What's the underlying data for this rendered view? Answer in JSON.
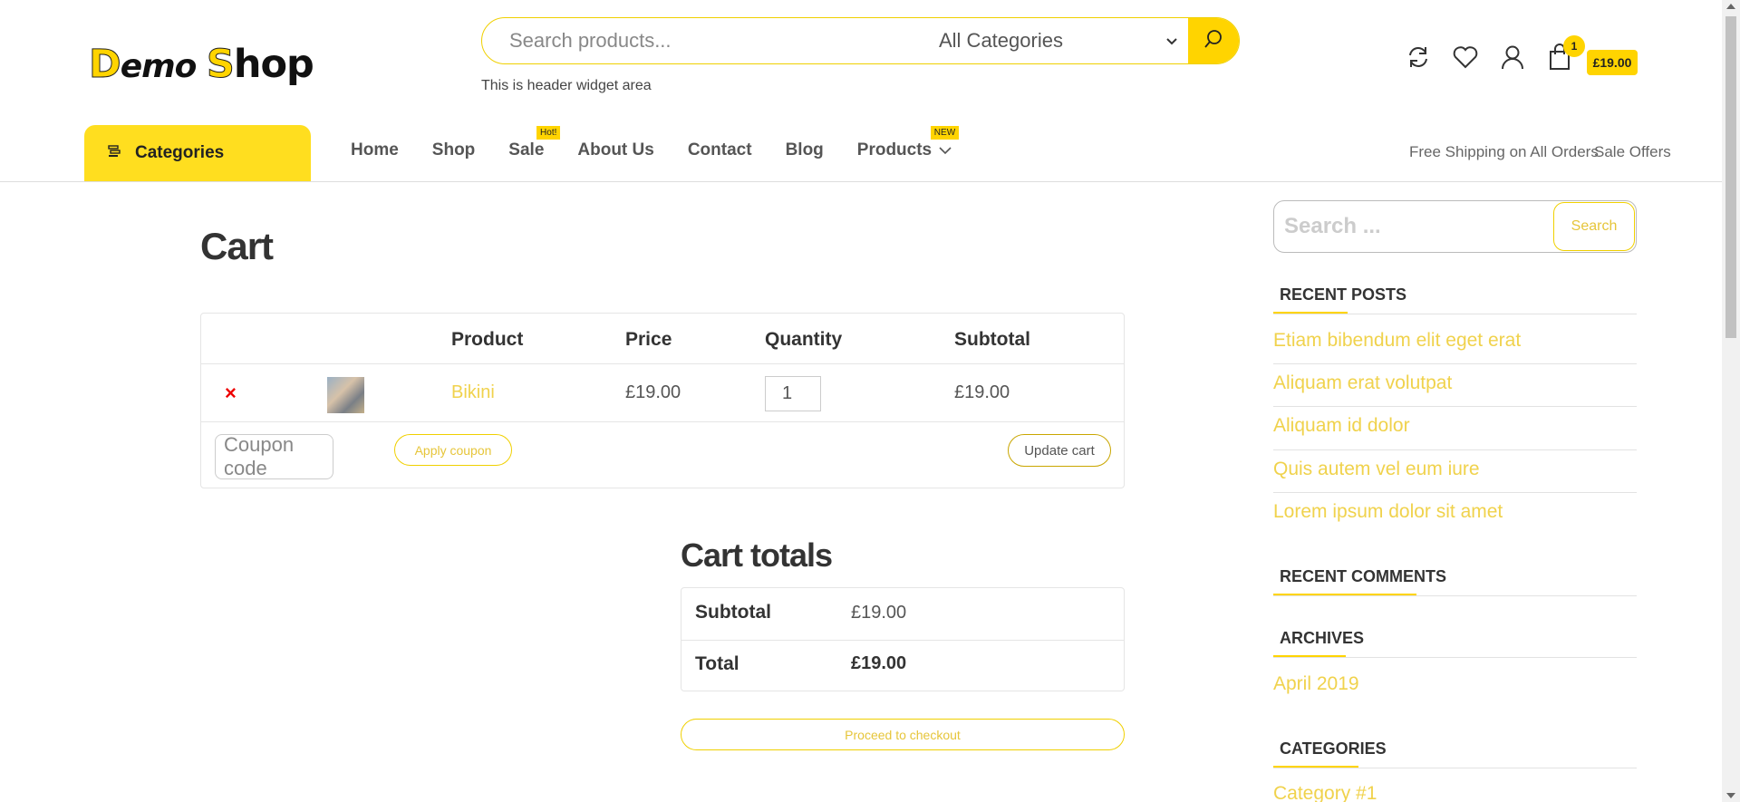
{
  "header": {
    "logo": {
      "part1": "D",
      "part2": "emo ",
      "part3": "S",
      "part4": "hop"
    },
    "search_placeholder": "Search products...",
    "category_select": "All Categories",
    "widget_text": "This is header widget area",
    "cart_count": "1",
    "cart_total": "£19.00",
    "icons": [
      "refresh-icon",
      "heart-icon",
      "user-icon",
      "shopping-bag-icon"
    ]
  },
  "nav": {
    "categories_label": "Categories",
    "items": [
      {
        "label": "Home"
      },
      {
        "label": "Shop"
      },
      {
        "label": "Sale",
        "badge": "Hot!"
      },
      {
        "label": "About Us"
      },
      {
        "label": "Contact"
      },
      {
        "label": "Blog"
      },
      {
        "label": "Products",
        "badge": "NEW"
      }
    ],
    "right_links": [
      "Free Shipping on All Orders",
      "Sale Offers"
    ]
  },
  "cart": {
    "title": "Cart",
    "headers": {
      "product": "Product",
      "price": "Price",
      "quantity": "Quantity",
      "subtotal": "Subtotal"
    },
    "items": [
      {
        "name": "Bikini",
        "price": "£19.00",
        "quantity": "1",
        "subtotal": "£19.00",
        "remove": "×"
      }
    ],
    "coupon_placeholder": "Coupon code",
    "apply_coupon": "Apply coupon",
    "update_cart": "Update cart"
  },
  "totals": {
    "title": "Cart totals",
    "subtotal_label": "Subtotal",
    "subtotal_value": "£19.00",
    "total_label": "Total",
    "total_value": "£19.00",
    "checkout": "Proceed to checkout"
  },
  "sidebar": {
    "search_placeholder": "Search ...",
    "search_button": "Search",
    "recent_posts_title": "RECENT POSTS",
    "recent_posts": [
      "Etiam bibendum elit eget erat",
      "Aliquam erat volutpat",
      "Aliquam id dolor",
      "Quis autem vel eum iure",
      "Lorem ipsum dolor sit amet"
    ],
    "recent_comments_title": "RECENT COMMENTS",
    "archives_title": "ARCHIVES",
    "archives": [
      "April 2019"
    ],
    "categories_title": "CATEGORIES",
    "categories": [
      "Category #1"
    ]
  },
  "colors": {
    "accent": "#ffd400",
    "link": "#f0d24c",
    "remove": "#ee0000"
  }
}
